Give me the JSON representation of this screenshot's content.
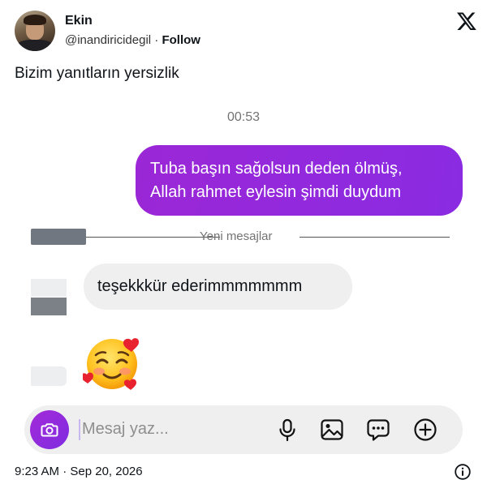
{
  "tweet": {
    "author_name": "Ekin",
    "handle": "@inandiricidegil",
    "separator": " · ",
    "follow_label": "Follow",
    "text": "Bizim yanıtların yersizlik",
    "footer": "9:23 AM · Sep 20, 2026"
  },
  "chat": {
    "time": "00:53",
    "outgoing_message_lines": [
      "Tuba başın sağolsun deden ölmüş,",
      "Allah rahmet eylesin şimdi duydum"
    ],
    "divider_label": "Yeni mesajlar",
    "incoming_message": "teşekkkür ederimmmmmmm",
    "emoji_name": "smiling-face-with-hearts",
    "composer_placeholder": "Mesaj yaz...",
    "accent_color": "#8a2be2"
  },
  "icons": [
    "x-logo-icon",
    "camera-icon",
    "microphone-icon",
    "image-icon",
    "sticker-chat-icon",
    "add-icon",
    "info-icon"
  ]
}
